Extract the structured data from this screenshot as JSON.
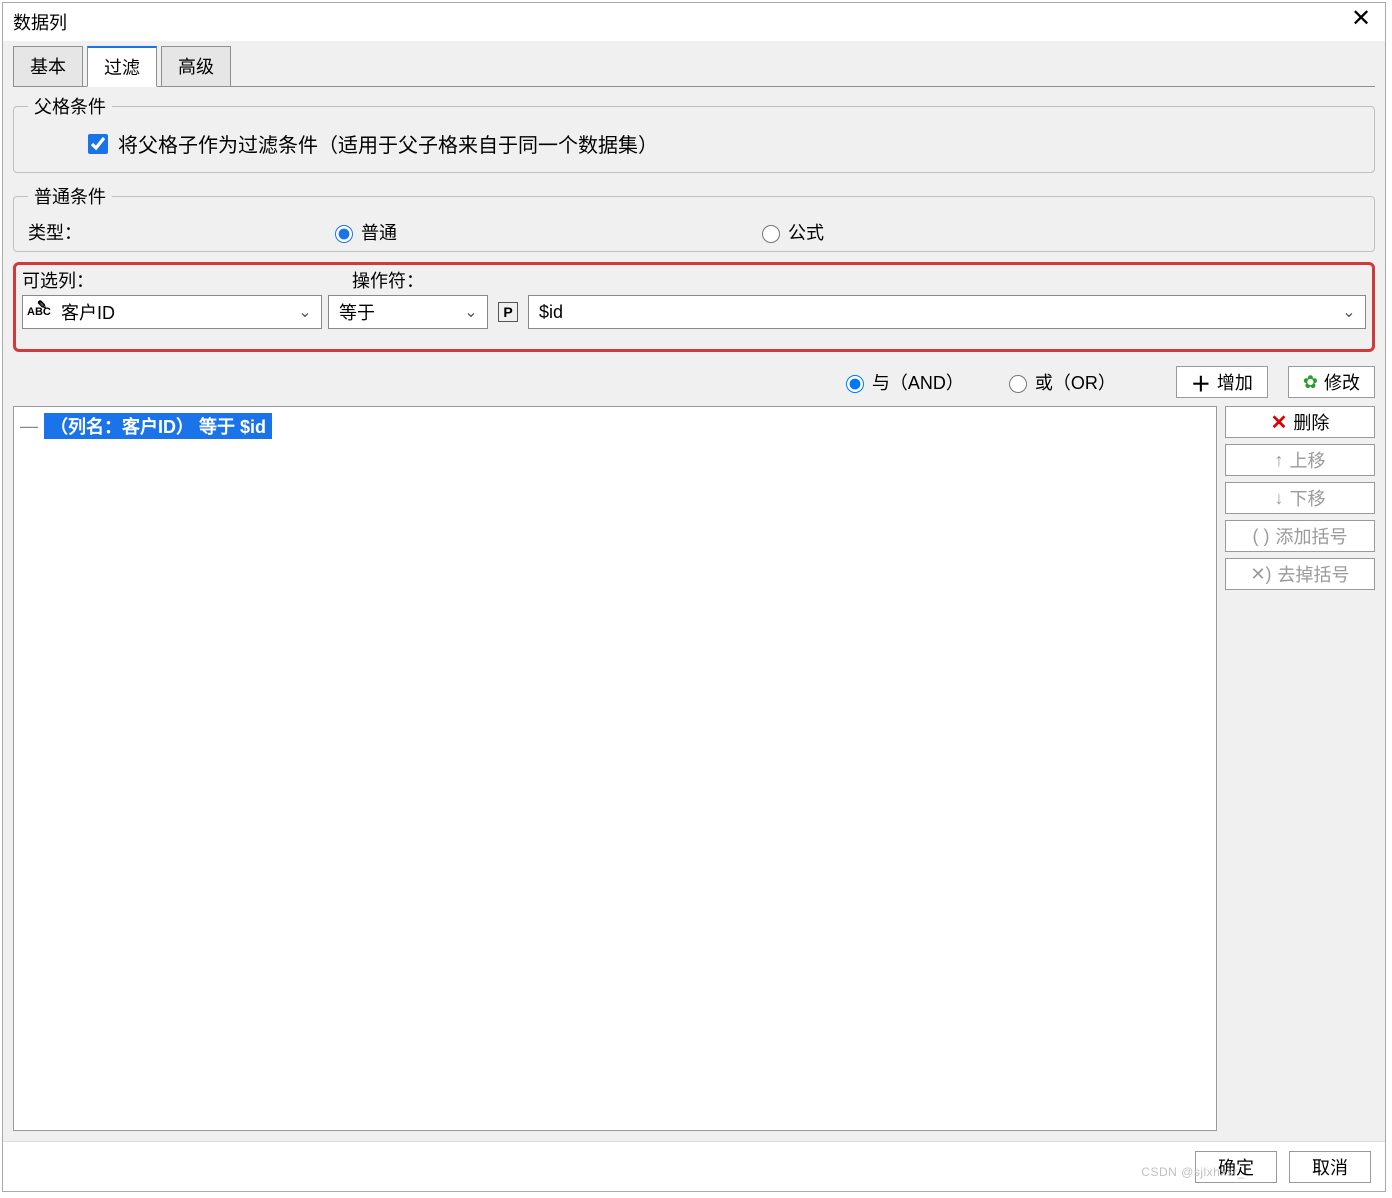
{
  "title": "数据列",
  "tabs": {
    "basic": "基本",
    "filter": "过滤",
    "advanced": "高级"
  },
  "parent": {
    "legend": "父格条件",
    "checkbox_label": "将父格子作为过滤条件（适用于父子格来自于同一个数据集）"
  },
  "normal": {
    "legend": "普通条件",
    "type_label": "类型：",
    "type_normal": "普通",
    "type_formula": "公式"
  },
  "red": {
    "col_label": "可选列：",
    "op_label": "操作符：",
    "column_value": "客户ID",
    "operator_value": "等于",
    "value_value": "$id",
    "icon_abc": "ABC",
    "icon_p": "P"
  },
  "andor": {
    "and_label": "与（AND）",
    "or_label": "或（OR）",
    "add": "增加",
    "edit": "修改"
  },
  "tree": {
    "dash": "—",
    "item": "（列名：客户ID） 等于 $id"
  },
  "side": {
    "delete": "删除",
    "up": "上移",
    "down": "下移",
    "add_paren": "添加括号",
    "rm_paren": "去掉括号",
    "paren_icon": "( )",
    "rm_icon": "✕)"
  },
  "footer": {
    "ok": "确定",
    "cancel": "取消"
  },
  "watermark": "CSDN @sjlxhxsr_"
}
